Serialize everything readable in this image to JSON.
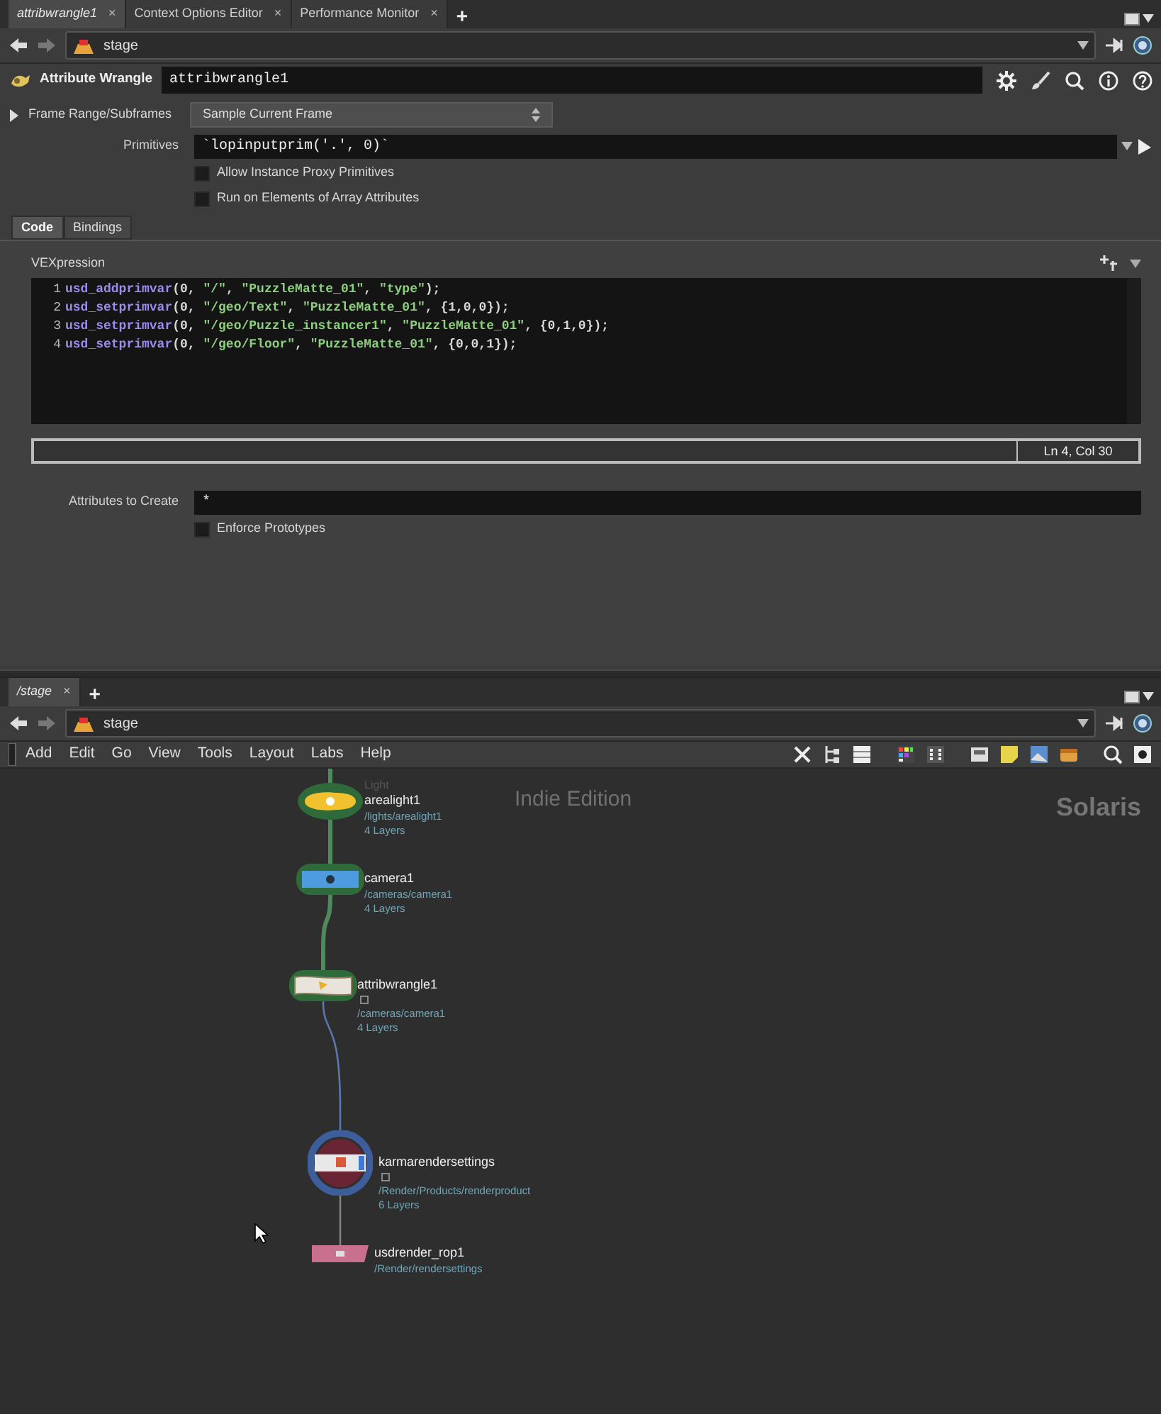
{
  "top_pane": {
    "tabs": [
      {
        "label": "attribwrangle1",
        "close": "×",
        "selected": true
      },
      {
        "label": "Context Options Editor",
        "close": "×",
        "selected": false
      },
      {
        "label": "Performance Monitor",
        "close": "×",
        "selected": false
      }
    ],
    "add_tab": "+",
    "path": "stage"
  },
  "parameters": {
    "node_type": "Attribute Wrangle",
    "node_name": "attribwrangle1",
    "frame_range": {
      "label": "Frame Range/Subframes",
      "value": "Sample Current Frame",
      "expanded": false
    },
    "primitives": {
      "label": "Primitives",
      "value": "`lopinputprim('.', 0)`"
    },
    "options": [
      {
        "label": "Allow Instance Proxy Primitives",
        "checked": false
      },
      {
        "label": "Run on Elements of Array Attributes",
        "checked": false
      }
    ],
    "tabs": [
      {
        "label": "Code",
        "selected": true
      },
      {
        "label": "Bindings",
        "selected": false
      }
    ],
    "vexpression": {
      "label": "VEXpression",
      "lines": [
        {
          "number": "1",
          "text": "usd_addprimvar(0, \"/\", \"PuzzleMatte_01\", \"type\");"
        },
        {
          "number": "2",
          "text": "usd_setprimvar(0, \"/geo/Text\", \"PuzzleMatte_01\", {1,0,0});"
        },
        {
          "number": "3",
          "text": "usd_setprimvar(0, \"/geo/Puzzle_instancer1\", \"PuzzleMatte_01\", {0,1,0});"
        },
        {
          "number": "4",
          "text": "usd_setprimvar(0, \"/geo/Floor\", \"PuzzleMatte_01\", {0,0,1});"
        }
      ],
      "cursor": "Ln 4, Col 30"
    },
    "attributes_to_create": {
      "label": "Attributes to Create",
      "value": "*"
    },
    "enforce_prototypes": {
      "label": "Enforce Prototypes",
      "checked": false
    }
  },
  "bottom_pane": {
    "tabs": [
      {
        "label": "/stage",
        "close": "×",
        "selected": true
      }
    ],
    "add_tab": "+",
    "path": "stage",
    "menu": [
      "Add",
      "Edit",
      "Go",
      "View",
      "Tools",
      "Layout",
      "Labs",
      "Help"
    ],
    "network": {
      "edition": "Indie Edition",
      "context": "Solaris",
      "nodes": [
        {
          "kind": "light",
          "name": "arealight1",
          "type_label": "Light",
          "path": "/lights/arealight1",
          "layers": "4 Layers",
          "color": "#f2c12e",
          "highlighted": true
        },
        {
          "kind": "camera",
          "name": "camera1",
          "path": "/cameras/camera1",
          "layers": "4 Layers",
          "color": "#4f9be0",
          "highlighted": true
        },
        {
          "kind": "wrangle",
          "name": "attribwrangle1",
          "path": "/cameras/camera1",
          "layers": "4 Layers",
          "color": "#e8e4dc",
          "highlighted": true
        },
        {
          "kind": "rendersettings",
          "name": "karmarendersettings",
          "path": "/Render/Products/renderproduct",
          "layers": "6 Layers",
          "color": "#e8e8e8",
          "highlighted": false
        },
        {
          "kind": "rop",
          "name": "usdrender_rop1",
          "path": "/Render/rendersettings",
          "color": "#c9708e",
          "highlighted": false
        }
      ]
    }
  }
}
